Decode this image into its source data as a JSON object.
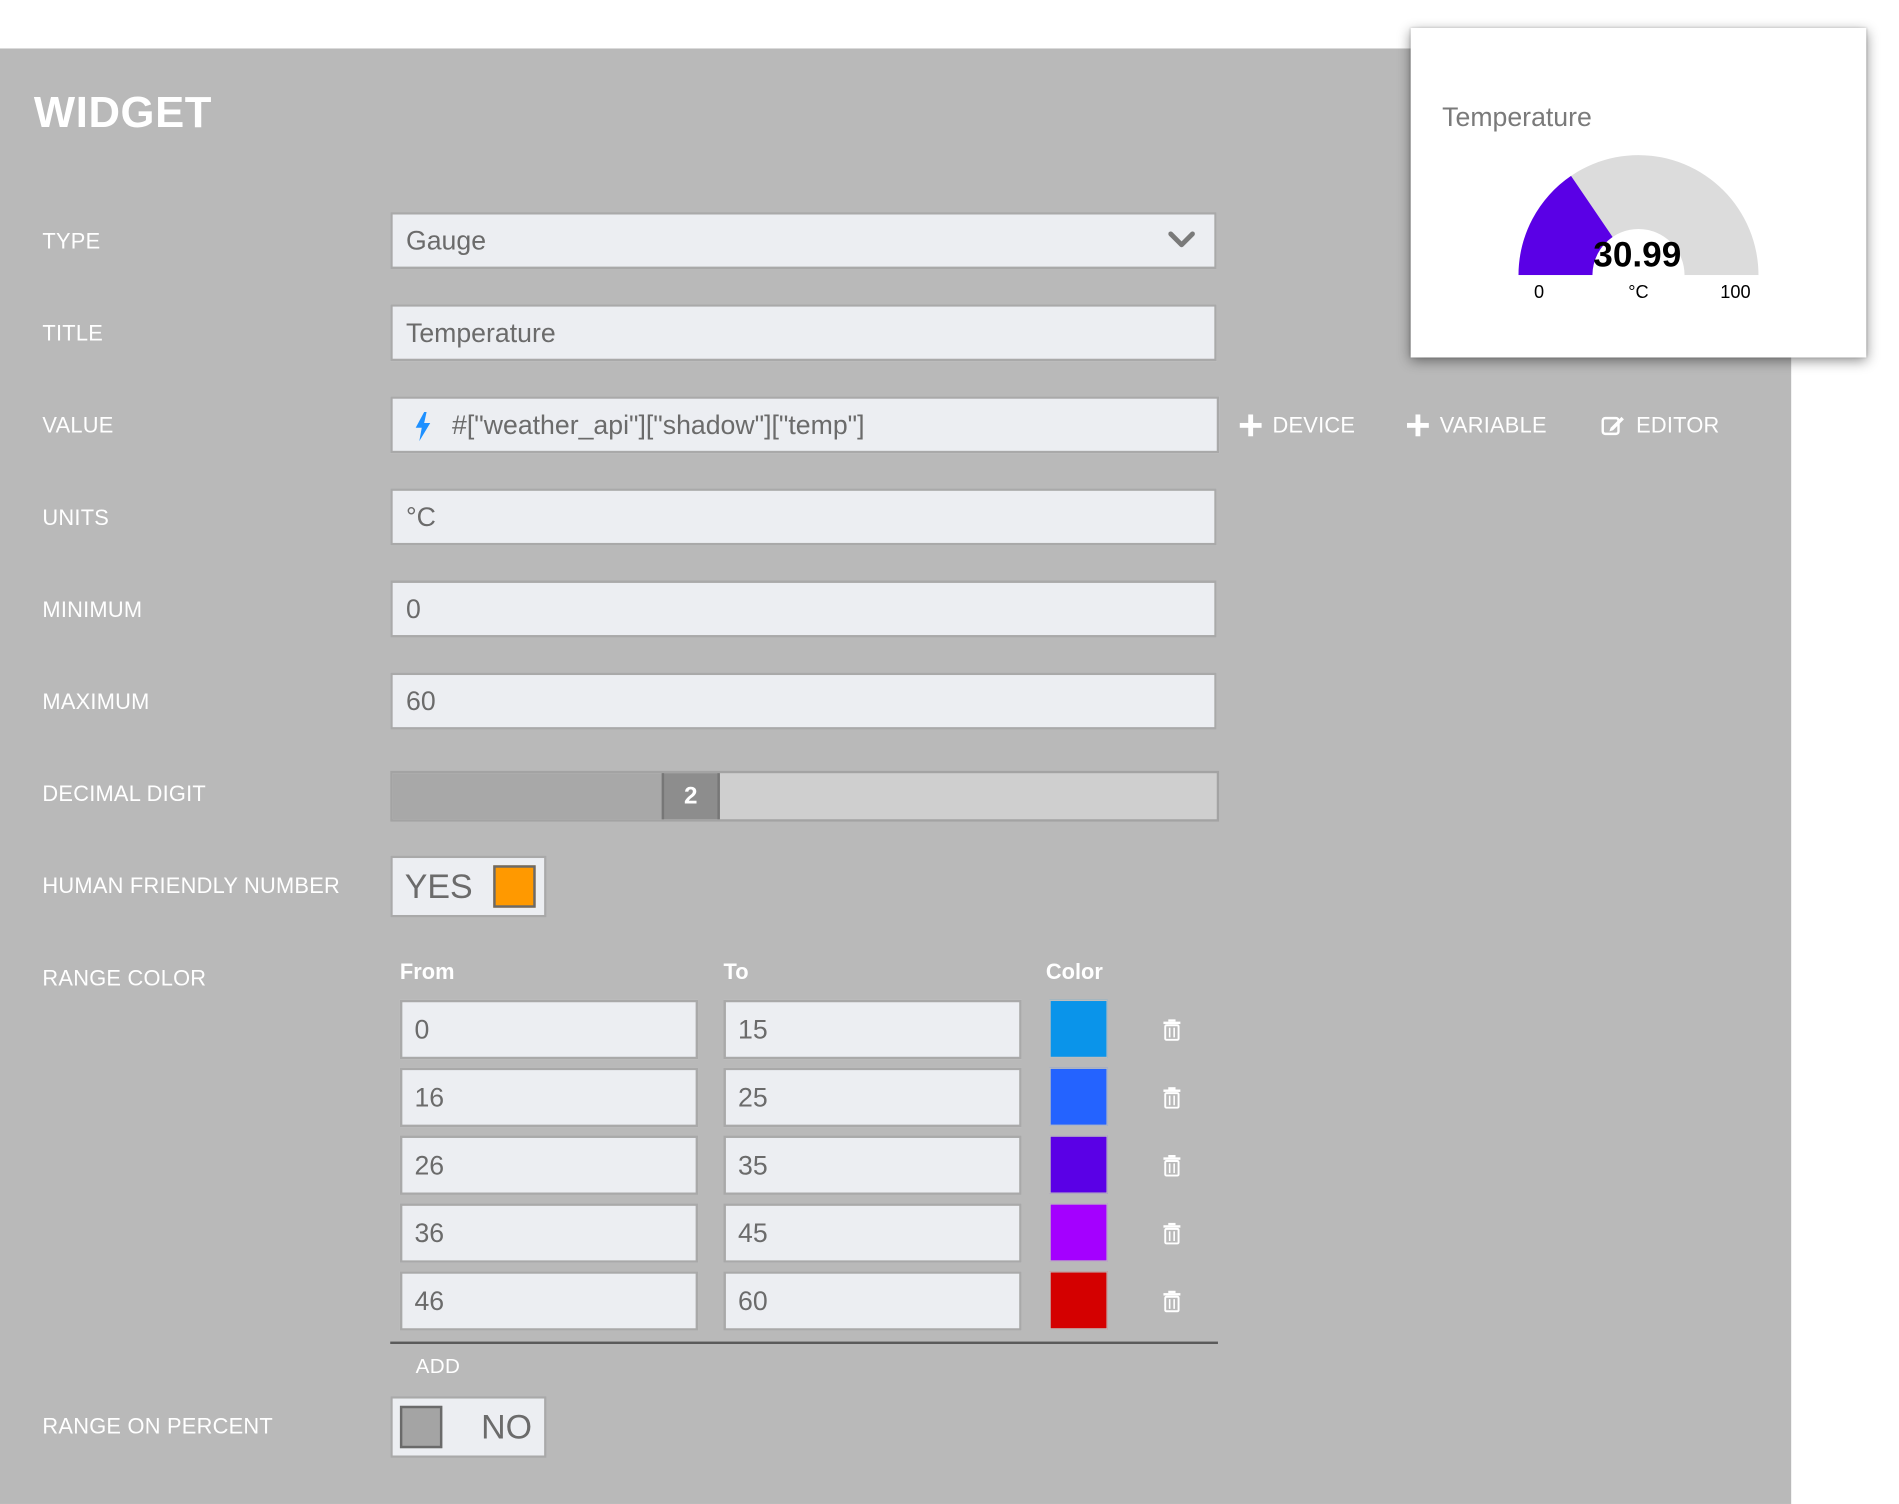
{
  "panel": {
    "title": "WIDGET"
  },
  "labels": {
    "type": "TYPE",
    "title": "TITLE",
    "value": "VALUE",
    "units": "UNITS",
    "minimum": "MINIMUM",
    "maximum": "MAXIMUM",
    "decimal_digit": "DECIMAL DIGIT",
    "human_friendly": "HUMAN FRIENDLY NUMBER",
    "range_color": "RANGE COLOR",
    "range_on_percent": "RANGE ON PERCENT"
  },
  "fields": {
    "type": {
      "value": "Gauge",
      "icon": "chevron-down-icon"
    },
    "title": "Temperature",
    "value": {
      "text": "#[\"weather_api\"][\"shadow\"][\"temp\"]",
      "icon": "bolt-icon",
      "icon_color": "#1e90ff"
    },
    "units": "°C",
    "minimum": "0",
    "maximum": "60"
  },
  "value_actions": {
    "device": "DEVICE",
    "variable": "VARIABLE",
    "editor": "EDITOR"
  },
  "decimal_digit": {
    "value": "2",
    "level": 0.33
  },
  "human_friendly": {
    "label": "YES",
    "checked": true,
    "color": "#ff9900"
  },
  "range_color": {
    "headers": {
      "from": "From",
      "to": "To",
      "color": "Color"
    },
    "rows": [
      {
        "from": "0",
        "to": "15",
        "color": "#0a94ea"
      },
      {
        "from": "16",
        "to": "25",
        "color": "#2463ff"
      },
      {
        "from": "26",
        "to": "35",
        "color": "#5a00e6"
      },
      {
        "from": "36",
        "to": "45",
        "color": "#a400ff"
      },
      {
        "from": "46",
        "to": "60",
        "color": "#d40000"
      }
    ],
    "add_label": "ADD"
  },
  "range_on_percent": {
    "label": "NO",
    "checked": false,
    "color": "#a4a4a4"
  },
  "preview": {
    "title": "Temperature",
    "value": "30.99",
    "value_numeric": 30.99,
    "min": "0",
    "units": "°C",
    "max": "100",
    "fill_color": "#5a00e6",
    "track_color": "#dcdcdc"
  }
}
